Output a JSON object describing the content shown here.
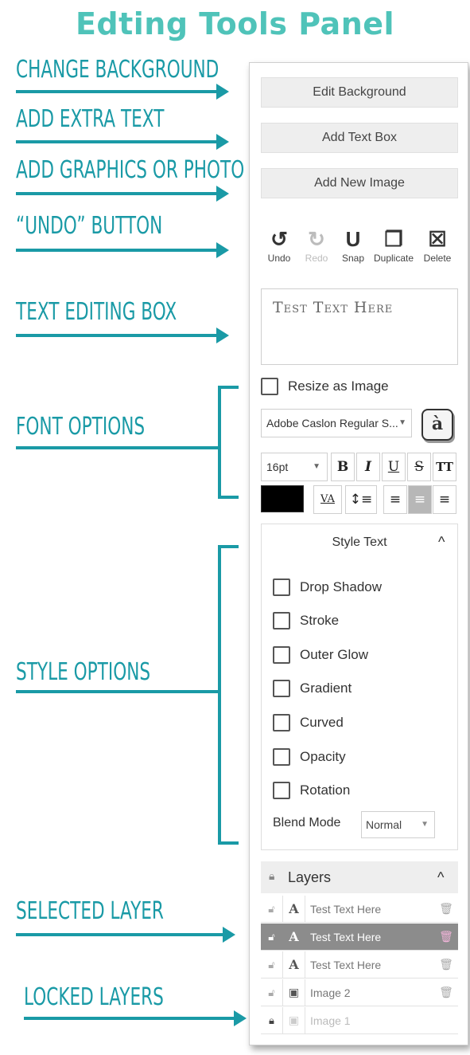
{
  "title": "Edting Tools Panel",
  "annotations": [
    {
      "label": "CHANGE BACKGROUND"
    },
    {
      "label": "ADD EXTRA TEXT"
    },
    {
      "label": "ADD GRAPHICS OR PHOTO"
    },
    {
      "label": "“UNDO” BUTTON"
    },
    {
      "label": "TEXT EDITING BOX"
    },
    {
      "label": "FONT OPTIONS"
    },
    {
      "label": "STYLE OPTIONS"
    },
    {
      "label": "SELECTED LAYER"
    },
    {
      "label": "LOCKED LAYERS"
    }
  ],
  "panel": {
    "buttons": {
      "edit_background": "Edit Background",
      "add_text_box": "Add Text Box",
      "add_new_image": "Add New Image"
    },
    "tools": [
      {
        "label": "Undo",
        "icon": "undo-icon",
        "glyph": "↺",
        "enabled": true
      },
      {
        "label": "Redo",
        "icon": "redo-icon",
        "glyph": "↻",
        "enabled": false
      },
      {
        "label": "Snap",
        "icon": "magnet-icon",
        "glyph": "U",
        "enabled": true
      },
      {
        "label": "Duplicate",
        "icon": "duplicate-icon",
        "glyph": "❐",
        "enabled": true
      },
      {
        "label": "Delete",
        "icon": "trash-icon",
        "glyph": "☒",
        "enabled": true
      }
    ],
    "text_box_value": "Test Text Here",
    "resize_as_image_label": "Resize as Image",
    "font": {
      "family_value": "Adobe Caslon Regular S...",
      "glyph_button": "à",
      "size_value": "16pt",
      "bold": "B",
      "italic": "I",
      "underline": "U",
      "strikethrough": "S",
      "all_caps": "TT",
      "kerning": "VA",
      "color": "#000000",
      "alignment_selected": "center"
    },
    "style_text": {
      "heading": "Style Text",
      "options": [
        "Drop Shadow",
        "Stroke",
        "Outer Glow",
        "Gradient",
        "Curved",
        "Opacity",
        "Rotation"
      ],
      "blend_mode_label": "Blend Mode",
      "blend_mode_value": "Normal"
    },
    "layers": {
      "heading": "Layers",
      "items": [
        {
          "name": "Test Text Here",
          "type": "text",
          "state": "normal"
        },
        {
          "name": "Test Text Here",
          "type": "text",
          "state": "selected"
        },
        {
          "name": "Test Text Here",
          "type": "text",
          "state": "normal"
        },
        {
          "name": "Image 2",
          "type": "image",
          "state": "normal"
        },
        {
          "name": "Image 1",
          "type": "image",
          "state": "locked"
        }
      ]
    }
  },
  "colors": {
    "annotation": "#1a9aa6",
    "title": "#4fc3b9",
    "selected_layer": "#8c8c8c"
  }
}
